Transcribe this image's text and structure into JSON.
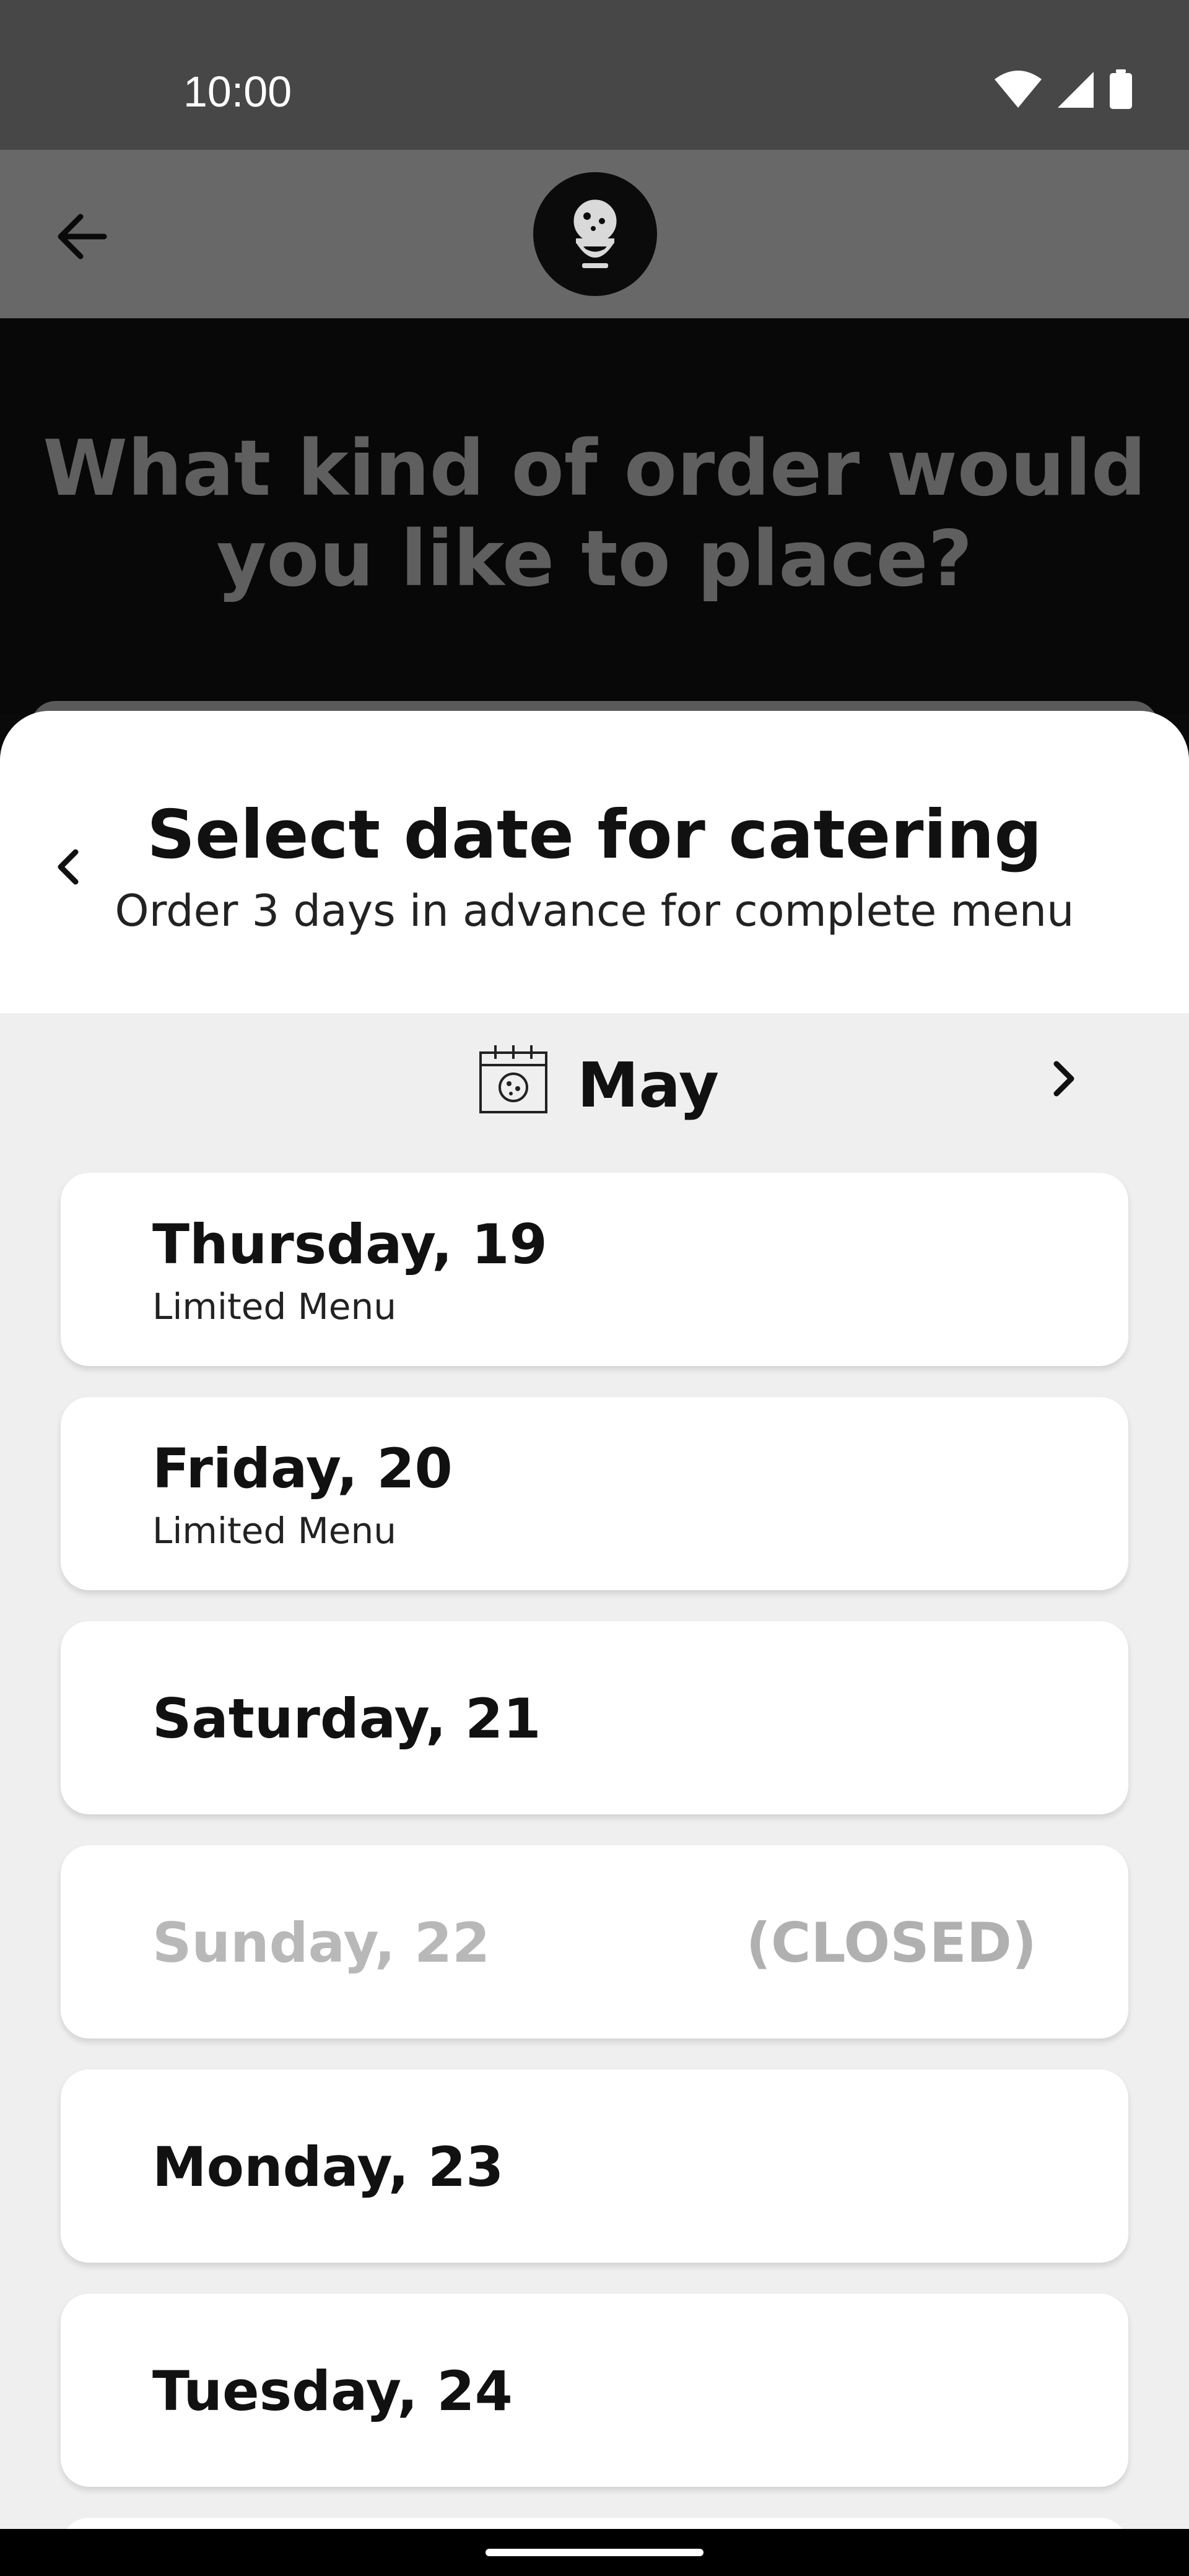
{
  "status_bar": {
    "time": "10:00",
    "icons": [
      "wifi-icon",
      "signal-icon",
      "battery-icon"
    ]
  },
  "app_bar": {
    "back_icon": "arrow-left-icon",
    "logo_icon": "chef-cookie-logo-icon"
  },
  "background": {
    "title": "What kind of order would you like to place?"
  },
  "sheet": {
    "title": "Select date for catering",
    "subtitle": "Order 3 days in advance for complete menu",
    "back_icon": "chevron-left-icon",
    "month": {
      "label": "May",
      "icon": "calendar-cookie-icon",
      "next_icon": "chevron-right-icon"
    },
    "dates": [
      {
        "label": "Thursday, 19",
        "sub": "Limited Menu"
      },
      {
        "label": "Friday, 20",
        "sub": "Limited Menu"
      },
      {
        "label": "Saturday, 21"
      },
      {
        "label": "Sunday, 22",
        "status": "(CLOSED)"
      },
      {
        "label": "Monday, 23"
      },
      {
        "label": "Tuesday, 24"
      }
    ]
  },
  "colors": {
    "status_bar_bg": "#474747",
    "app_bar_bg": "#686868",
    "sheet_bg": "#efefef",
    "card_bg": "#ffffff",
    "closed_text": "#b8b8b8"
  }
}
